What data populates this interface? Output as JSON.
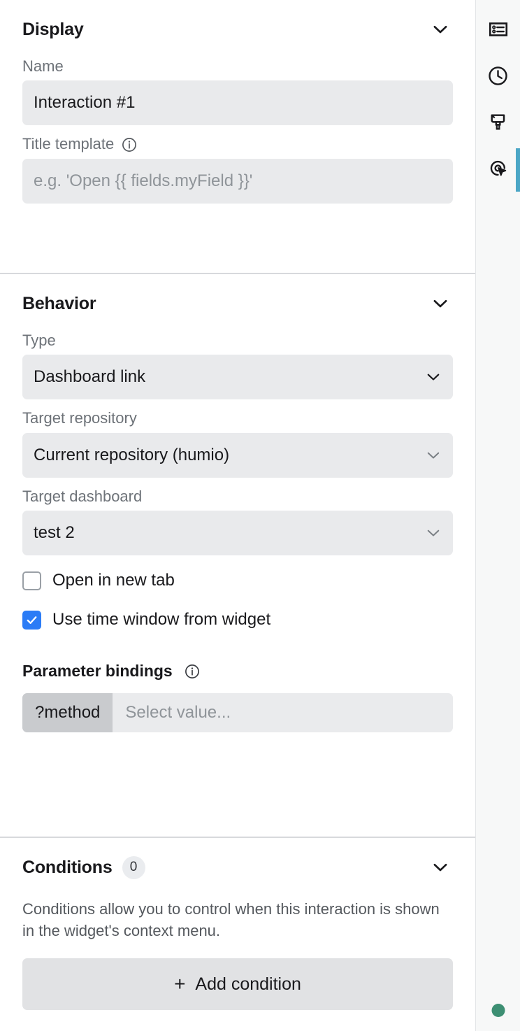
{
  "panel": {
    "sections": [
      {
        "id": "display",
        "title": "Display",
        "collapse_icon": "chevron-down-icon",
        "fields": {
          "name_label": "Name",
          "name_value": "Interaction #1",
          "title_template_label": "Title template",
          "title_template_info_icon": "info-icon",
          "title_template_placeholder": "e.g. 'Open {{ fields.myField }}'"
        }
      },
      {
        "id": "behavior",
        "title": "Behavior",
        "collapse_icon": "chevron-down-icon",
        "fields": {
          "type_label": "Type",
          "type_value": "Dashboard link",
          "target_repository_label": "Target repository",
          "target_repository_value": "Current repository (humio)",
          "target_dashboard_label": "Target dashboard",
          "target_dashboard_value": "test 2",
          "open_new_tab_label": "Open in new tab",
          "open_new_tab_checked": false,
          "use_time_window_label": "Use time window from widget",
          "use_time_window_checked": true,
          "parameter_bindings_label": "Parameter bindings",
          "parameter_bindings_info_icon": "info-icon",
          "bindings": [
            {
              "key": "?method",
              "value_placeholder": "Select value..."
            }
          ]
        }
      },
      {
        "id": "conditions",
        "title": "Conditions",
        "badge": "0",
        "collapse_icon": "chevron-down-icon",
        "description": "Conditions allow you to control when this interaction is shown in the widget's context menu.",
        "add_button_label": "Add condition",
        "add_button_icon": "plus-icon"
      }
    ]
  },
  "right_rail": {
    "items": [
      {
        "name": "widget-settings-icon",
        "icon": "list-form-icon",
        "active": false
      },
      {
        "name": "time-settings-icon",
        "icon": "clock-icon",
        "active": false
      },
      {
        "name": "styling-icon",
        "icon": "paintbrush-icon",
        "active": false
      },
      {
        "name": "interactions-icon",
        "icon": "cursor-target-icon",
        "active": true
      }
    ],
    "status_indicator": "connected-status-dot"
  },
  "colors": {
    "accent_active": "#4ba6c6",
    "checkbox_checked": "#2b7cf6",
    "status_green": "#3d8f73",
    "field_background": "#e9eaec",
    "param_key_background": "#c9cbce",
    "divider": "#d7d9dc",
    "rail_background": "#f7f8f8"
  }
}
